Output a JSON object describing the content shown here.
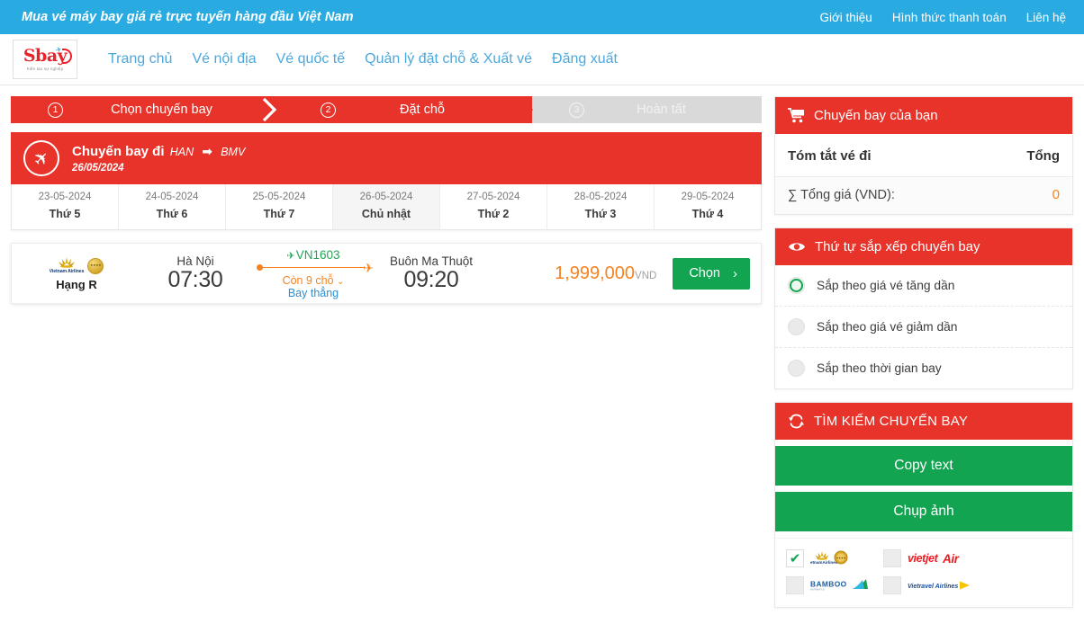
{
  "topbar": {
    "slogan": "Mua vé máy bay giá rẻ trực tuyến hàng đầu Việt Nam",
    "links": [
      {
        "label": "Giới thiệu"
      },
      {
        "label": "Hình thức thanh toán"
      },
      {
        "label": "Liên hệ"
      }
    ]
  },
  "header": {
    "logo_text": "Sbay",
    "logo_sub": "Kiến tạo sự nghiệp",
    "nav": [
      {
        "label": "Trang chủ"
      },
      {
        "label": "Vé nội địa"
      },
      {
        "label": "Vé quốc tế"
      },
      {
        "label": "Quản lý đặt chỗ & Xuất vé"
      },
      {
        "label": "Đăng xuất"
      }
    ]
  },
  "steps": [
    {
      "num": "1",
      "label": "Chọn chuyến bay",
      "state": "active"
    },
    {
      "num": "2",
      "label": "Đặt chỗ",
      "state": "active"
    },
    {
      "num": "3",
      "label": "Hoàn tất",
      "state": "inactive"
    }
  ],
  "flight_banner": {
    "title": "Chuyến bay đi",
    "from": "HAN",
    "to": "BMV",
    "arrow": "➡",
    "date": "26/05/2024",
    "icon": "airplane-icon"
  },
  "date_strip": [
    {
      "date": "23-05-2024",
      "weekday": "Thứ 5",
      "active": false
    },
    {
      "date": "24-05-2024",
      "weekday": "Thứ 6",
      "active": false
    },
    {
      "date": "25-05-2024",
      "weekday": "Thứ 7",
      "active": false
    },
    {
      "date": "26-05-2024",
      "weekday": "Chủ nhật",
      "active": true
    },
    {
      "date": "27-05-2024",
      "weekday": "Thứ 2",
      "active": false
    },
    {
      "date": "28-05-2024",
      "weekday": "Thứ 3",
      "active": false
    },
    {
      "date": "29-05-2024",
      "weekday": "Thứ 4",
      "active": false
    }
  ],
  "flights": [
    {
      "airline": "Vietnam Airlines",
      "fare_class": "Hạng R",
      "depart_city": "Hà Nội",
      "depart_time": "07:30",
      "flight_code": "VN1603",
      "seats_left": "Còn 9 chỗ",
      "stop_info": "Bay thẳng",
      "arrive_city": "Buôn Ma Thuột",
      "arrive_time": "09:20",
      "price": "1,999,000",
      "currency": "VND",
      "select_label": "Chọn"
    }
  ],
  "sidebar": {
    "cart_panel": {
      "icon": "cart-icon",
      "title": "Chuyến bay của bạn",
      "summary_label": "Tóm tắt vé đi",
      "summary_total_label": "Tổng",
      "total_row_label": "∑ Tổng giá (VND):",
      "total_row_value": "0"
    },
    "sort_panel": {
      "icon": "eye-icon",
      "title": "Thứ tự sắp xếp chuyến bay",
      "options": [
        {
          "label": "Sắp theo giá vé tăng dần",
          "selected": true
        },
        {
          "label": "Sắp theo giá vé giảm dần",
          "selected": false
        },
        {
          "label": "Sắp theo thời gian bay",
          "selected": false
        }
      ]
    },
    "search_panel": {
      "icon": "refresh-icon",
      "title": "TÌM KIẾM CHUYẾN BAY",
      "buttons": [
        {
          "label": "Copy text"
        },
        {
          "label": "Chụp ảnh"
        }
      ],
      "airlines": [
        {
          "name": "Vietnam Airlines",
          "checked": true
        },
        {
          "name": "VietJet Air",
          "checked": false
        },
        {
          "name": "Bamboo Airways",
          "checked": false
        },
        {
          "name": "Vietravel Airlines",
          "checked": false
        }
      ]
    }
  },
  "colors": {
    "brand_red": "#E8332A",
    "brand_blue": "#29ABE2",
    "nav_blue": "#4BA8DE",
    "accent_orange": "#F5821F",
    "green": "#13A452",
    "flight_code_green": "#23A455"
  }
}
